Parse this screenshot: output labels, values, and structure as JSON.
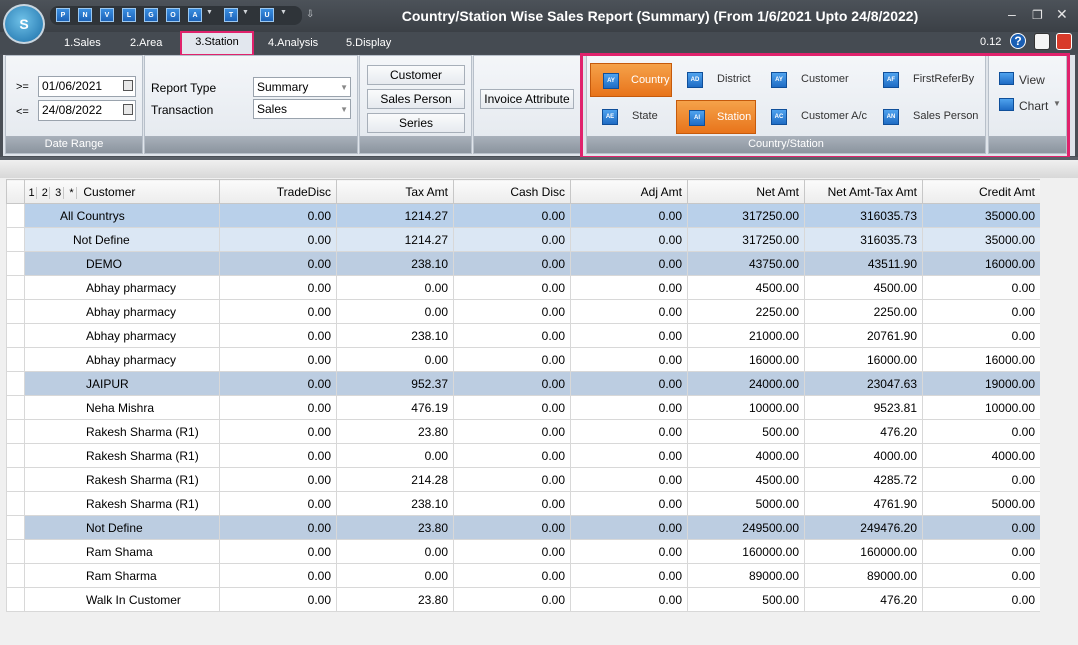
{
  "app": {
    "logo_text": "S",
    "title": "Country/Station Wise Sales Report (Summary) (From 1/6/2021 Upto 24/8/2022)",
    "window_controls": [
      "–",
      "❐",
      "✕"
    ],
    "quick_access": [
      "P",
      "N",
      "V",
      "L",
      "G",
      "O",
      "A",
      "T",
      "U"
    ]
  },
  "tabs": [
    "1.Sales",
    "2.Area",
    "3.Station",
    "4.Analysis",
    "5.Display"
  ],
  "active_tab": "3.Station",
  "version": "0.12",
  "help_icon": "?",
  "date_range": {
    "from_label": ">=",
    "from": "01/06/2021",
    "to_label": "<=",
    "to": "24/08/2022",
    "footer": "Date Range"
  },
  "report": {
    "type_label": "Report Type",
    "type_value": "Summary",
    "transaction_label": "Transaction",
    "transaction_value": "Sales"
  },
  "filters": [
    "Customer",
    "Sales Person",
    "Series"
  ],
  "invoice_attribute": "Invoice Attribute",
  "country_station": {
    "footer": "Country/Station",
    "options": [
      {
        "label": "Country",
        "selected": true,
        "icon": "AY"
      },
      {
        "label": "District",
        "selected": false,
        "icon": "AD"
      },
      {
        "label": "Customer",
        "selected": false,
        "icon": "AY"
      },
      {
        "label": "FirstReferBy",
        "selected": false,
        "icon": "AF"
      },
      {
        "label": "State",
        "selected": false,
        "icon": "AE"
      },
      {
        "label": "Station",
        "selected": true,
        "icon": "AI"
      },
      {
        "label": "Customer A/c",
        "selected": false,
        "icon": "AC"
      },
      {
        "label": "Sales Person",
        "selected": false,
        "icon": "AN"
      }
    ]
  },
  "view_group": {
    "view": "View",
    "chart": "Chart"
  },
  "grid": {
    "level_buttons": [
      "1",
      "2",
      "3",
      "*"
    ],
    "columns": [
      "Customer",
      "TradeDisc",
      "Tax Amt",
      "Cash Disc",
      "Adj Amt",
      "Net Amt",
      "Net Amt-Tax Amt",
      "Credit Amt"
    ],
    "rows": [
      {
        "level": 0,
        "name": "All Countrys",
        "trade_disc": "0.00",
        "tax_amt": "1214.27",
        "cash_disc": "0.00",
        "adj_amt": "0.00",
        "net_amt": "317250.00",
        "net_minus_tax": "316035.73",
        "credit_amt": "35000.00"
      },
      {
        "level": 1,
        "name": "Not Define",
        "trade_disc": "0.00",
        "tax_amt": "1214.27",
        "cash_disc": "0.00",
        "adj_amt": "0.00",
        "net_amt": "317250.00",
        "net_minus_tax": "316035.73",
        "credit_amt": "35000.00"
      },
      {
        "level": 2,
        "name": "DEMO",
        "trade_disc": "0.00",
        "tax_amt": "238.10",
        "cash_disc": "0.00",
        "adj_amt": "0.00",
        "net_amt": "43750.00",
        "net_minus_tax": "43511.90",
        "credit_amt": "16000.00"
      },
      {
        "level": 3,
        "name": "Abhay pharmacy",
        "trade_disc": "0.00",
        "tax_amt": "0.00",
        "cash_disc": "0.00",
        "adj_amt": "0.00",
        "net_amt": "4500.00",
        "net_minus_tax": "4500.00",
        "credit_amt": "0.00"
      },
      {
        "level": 3,
        "name": "Abhay pharmacy",
        "trade_disc": "0.00",
        "tax_amt": "0.00",
        "cash_disc": "0.00",
        "adj_amt": "0.00",
        "net_amt": "2250.00",
        "net_minus_tax": "2250.00",
        "credit_amt": "0.00"
      },
      {
        "level": 3,
        "name": "Abhay pharmacy",
        "trade_disc": "0.00",
        "tax_amt": "238.10",
        "cash_disc": "0.00",
        "adj_amt": "0.00",
        "net_amt": "21000.00",
        "net_minus_tax": "20761.90",
        "credit_amt": "0.00"
      },
      {
        "level": 3,
        "name": "Abhay pharmacy",
        "trade_disc": "0.00",
        "tax_amt": "0.00",
        "cash_disc": "0.00",
        "adj_amt": "0.00",
        "net_amt": "16000.00",
        "net_minus_tax": "16000.00",
        "credit_amt": "16000.00"
      },
      {
        "level": 2,
        "name": "JAIPUR",
        "trade_disc": "0.00",
        "tax_amt": "952.37",
        "cash_disc": "0.00",
        "adj_amt": "0.00",
        "net_amt": "24000.00",
        "net_minus_tax": "23047.63",
        "credit_amt": "19000.00"
      },
      {
        "level": 3,
        "name": "Neha Mishra",
        "trade_disc": "0.00",
        "tax_amt": "476.19",
        "cash_disc": "0.00",
        "adj_amt": "0.00",
        "net_amt": "10000.00",
        "net_minus_tax": "9523.81",
        "credit_amt": "10000.00"
      },
      {
        "level": 3,
        "name": "Rakesh Sharma (R1)",
        "trade_disc": "0.00",
        "tax_amt": "23.80",
        "cash_disc": "0.00",
        "adj_amt": "0.00",
        "net_amt": "500.00",
        "net_minus_tax": "476.20",
        "credit_amt": "0.00"
      },
      {
        "level": 3,
        "name": "Rakesh Sharma (R1)",
        "trade_disc": "0.00",
        "tax_amt": "0.00",
        "cash_disc": "0.00",
        "adj_amt": "0.00",
        "net_amt": "4000.00",
        "net_minus_tax": "4000.00",
        "credit_amt": "4000.00"
      },
      {
        "level": 3,
        "name": "Rakesh Sharma (R1)",
        "trade_disc": "0.00",
        "tax_amt": "214.28",
        "cash_disc": "0.00",
        "adj_amt": "0.00",
        "net_amt": "4500.00",
        "net_minus_tax": "4285.72",
        "credit_amt": "0.00"
      },
      {
        "level": 3,
        "name": "Rakesh Sharma (R1)",
        "trade_disc": "0.00",
        "tax_amt": "238.10",
        "cash_disc": "0.00",
        "adj_amt": "0.00",
        "net_amt": "5000.00",
        "net_minus_tax": "4761.90",
        "credit_amt": "5000.00"
      },
      {
        "level": 2,
        "name": "Not Define",
        "trade_disc": "0.00",
        "tax_amt": "23.80",
        "cash_disc": "0.00",
        "adj_amt": "0.00",
        "net_amt": "249500.00",
        "net_minus_tax": "249476.20",
        "credit_amt": "0.00"
      },
      {
        "level": 3,
        "name": "Ram Shama",
        "trade_disc": "0.00",
        "tax_amt": "0.00",
        "cash_disc": "0.00",
        "adj_amt": "0.00",
        "net_amt": "160000.00",
        "net_minus_tax": "160000.00",
        "credit_amt": "0.00"
      },
      {
        "level": 3,
        "name": "Ram Sharma",
        "trade_disc": "0.00",
        "tax_amt": "0.00",
        "cash_disc": "0.00",
        "adj_amt": "0.00",
        "net_amt": "89000.00",
        "net_minus_tax": "89000.00",
        "credit_amt": "0.00"
      },
      {
        "level": 3,
        "name": "Walk In Customer",
        "trade_disc": "0.00",
        "tax_amt": "23.80",
        "cash_disc": "0.00",
        "adj_amt": "0.00",
        "net_amt": "500.00",
        "net_minus_tax": "476.20",
        "credit_amt": "0.00"
      }
    ]
  }
}
